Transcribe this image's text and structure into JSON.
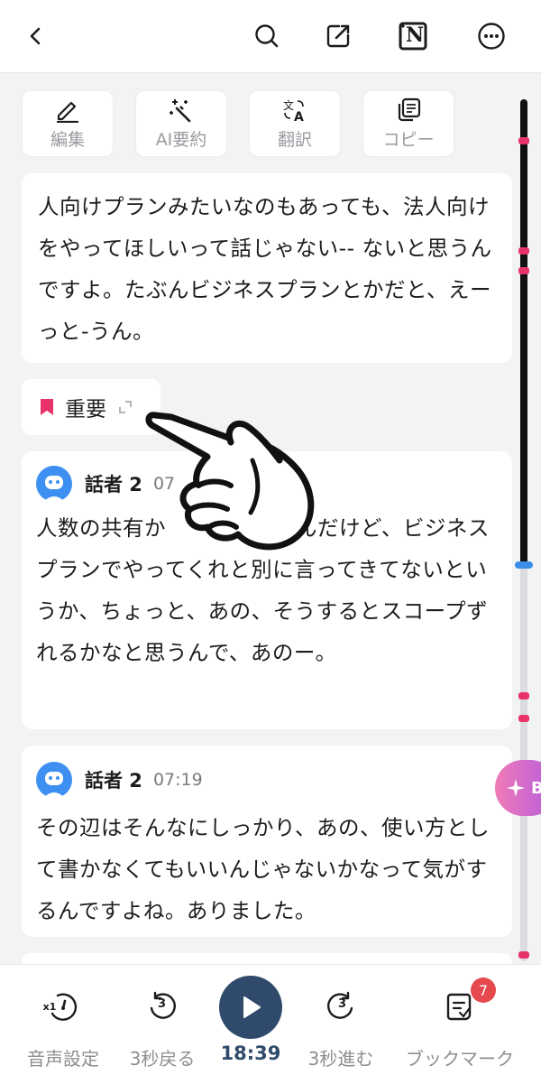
{
  "toolbar_top": {
    "back": "back",
    "icons": [
      "search-icon",
      "edit-share-icon",
      "notion-icon",
      "more-icon"
    ],
    "notion_letter": "N"
  },
  "tools": [
    {
      "label": "編集",
      "icon": "pencil-icon"
    },
    {
      "label": "AI要約",
      "icon": "magic-wand-icon"
    },
    {
      "label": "翻訳",
      "icon": "translate-icon"
    },
    {
      "label": "コピー",
      "icon": "copy-icon"
    }
  ],
  "transcript": {
    "first_text": "人向けプランみたいなのもあっても、法人向けをやってほしいって話じゃない-- ないと思うんですよ。たぶんビジネスプランとかだと、えーっと-うん。",
    "important_label": "重要",
    "entries": [
      {
        "speaker": "話者 2",
        "time": "07",
        "text": "人数の共有か　　　　　うんだけど、ビジネスプランでやってくれと別に言ってきてないというか、ちょっと、あの、そうするとスコープずれるかなと思うんで、あのー。"
      },
      {
        "speaker": "話者 2",
        "time": "07:19",
        "text": "その辺はそんなにしっかり、あの、使い方として書かなくてもいいんじゃないかなって気がするんですよね。ありました。"
      }
    ]
  },
  "ai_fab_label": "B",
  "player": {
    "audio_settings": "音声設定",
    "speed_badge": "x1",
    "back3": "3秒戻る",
    "back3_num": "3",
    "time": "18:39",
    "fwd3": "3秒進む",
    "fwd3_num": "3",
    "bookmark": "ブックマーク",
    "bookmark_count": "7"
  },
  "colors": {
    "accent": "#2f4a6b",
    "marker": "#e8336a",
    "avatar": "#3d8ff2",
    "badge": "#e5484d"
  }
}
